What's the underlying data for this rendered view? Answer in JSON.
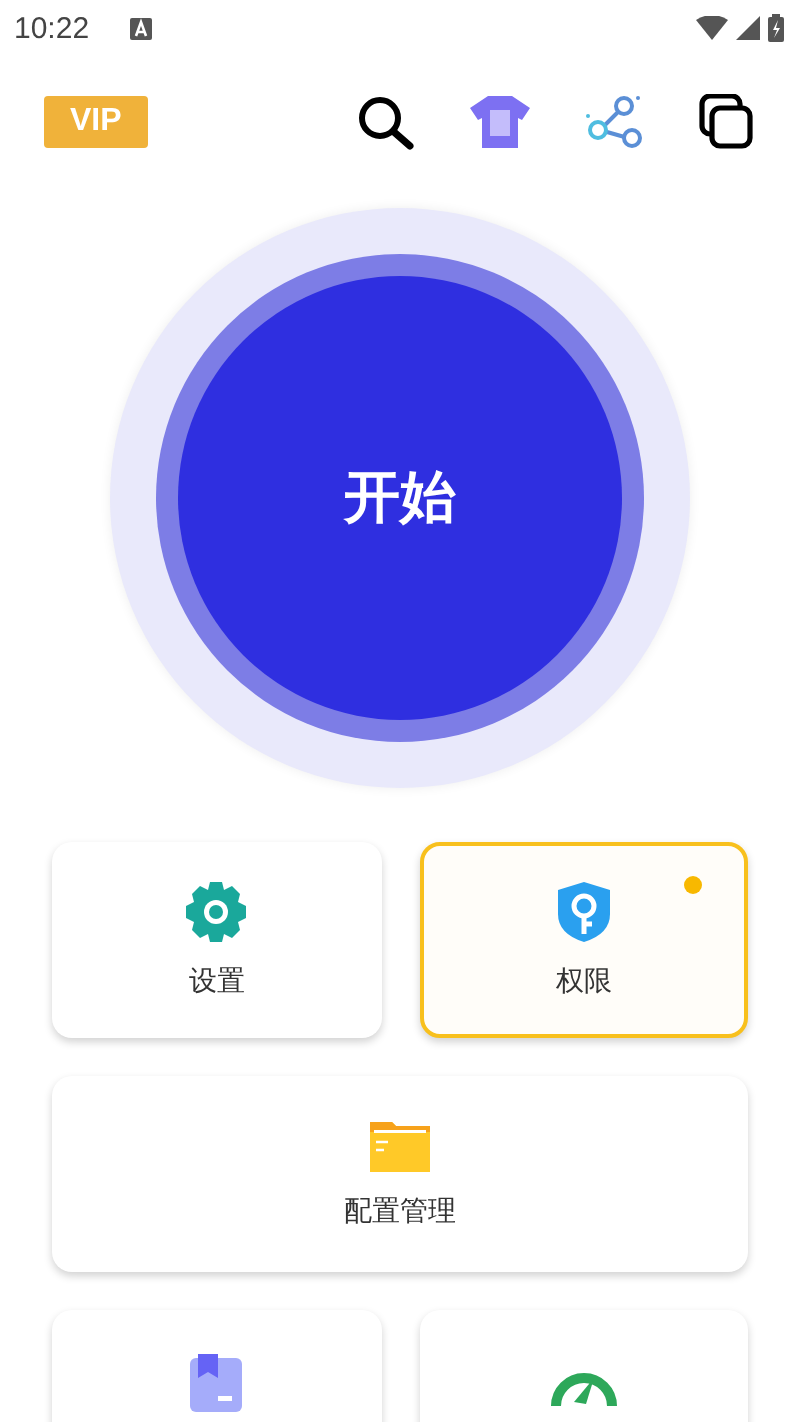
{
  "status_bar": {
    "time": "10:22"
  },
  "header": {
    "vip": "VIP"
  },
  "start_button": {
    "label": "开始"
  },
  "tiles": [
    {
      "kind": "half",
      "label": "设置",
      "alert": false
    },
    {
      "kind": "half",
      "label": "权限",
      "alert": true
    },
    {
      "kind": "wide",
      "label": "配置管理",
      "alert": false
    },
    {
      "kind": "half",
      "alert": false
    },
    {
      "kind": "half",
      "alert": false
    }
  ]
}
